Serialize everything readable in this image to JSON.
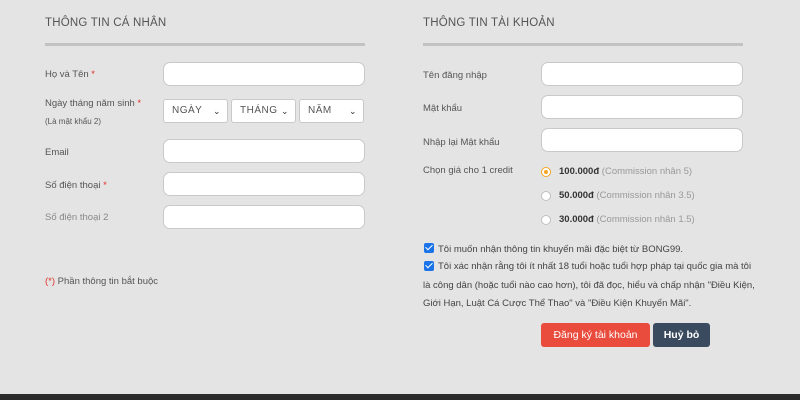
{
  "personal": {
    "title": "THÔNG TIN CÁ NHÂN",
    "fullname_label": "Họ và Tên",
    "birthday_label": "Ngày tháng năm sinh",
    "birthday_note": "(Là mật khẩu 2)",
    "day_value": "NGÀY",
    "month_value": "THÁNG",
    "year_value": "NĂM",
    "email_label": "Email",
    "phone_label": "Số điện thoại",
    "phone2_label": "Số điện thoại 2",
    "required_marker": "*",
    "required_note_marker": "(*)",
    "required_note": "Phần thông tin bắt buộc"
  },
  "account": {
    "title": "THÔNG TIN TÀI KHOẢN",
    "username_label": "Tên đăng nhập",
    "password_label": "Mật khẩu",
    "password_confirm_label": "Nhập lại Mật khẩu",
    "credit_label": "Chọn giá cho 1 credit",
    "credit_options": [
      {
        "price": "100.000đ",
        "commission": "(Commission nhân 5)",
        "selected": true
      },
      {
        "price": "50.000đ",
        "commission": "(Commission nhân 3.5)",
        "selected": false
      },
      {
        "price": "30.000đ",
        "commission": "(Commission nhân 1.5)",
        "selected": false
      }
    ],
    "promo_consent": "Tôi muốn nhận thông tin khuyến mãi đặc biệt từ BONG99.",
    "age_consent_line1": "Tôi xác nhận rằng tôi ít nhất 18 tuổi hoặc tuổi hợp pháp tại quốc gia mà tôi",
    "age_consent_line2": "là công dân (hoặc tuổi nào cao hơn), tôi đã đọc, hiểu và chấp nhận \"Điều Kiện,",
    "age_consent_line3": "Giới Hạn, Luật Cá Cược Thể Thao\" và \"Điều Kiện Khuyến Mãi\".",
    "register_label": "Đăng ký tài khoản",
    "cancel_label": "Huỷ bỏ"
  },
  "colors": {
    "accent_orange": "#f5a623",
    "register_red": "#e94b3c",
    "cancel_navy": "#3a4a5f",
    "checkbox_blue": "#1a73e8",
    "required_red": "#e0302a"
  }
}
